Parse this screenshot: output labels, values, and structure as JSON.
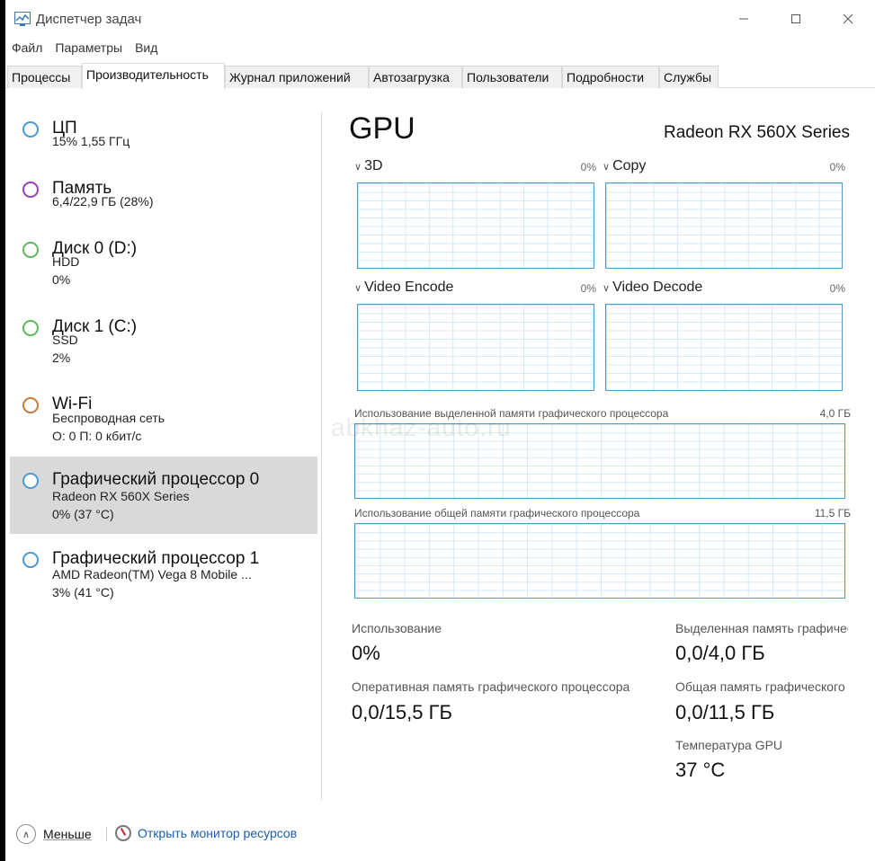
{
  "window": {
    "title": "Диспетчер задач"
  },
  "menu": [
    "Файл",
    "Параметры",
    "Вид"
  ],
  "tabs": [
    "Процессы",
    "Производительность",
    "Журнал приложений",
    "Автозагрузка",
    "Пользователи",
    "Подробности",
    "Службы"
  ],
  "active_tab": "Производительность",
  "sidebar": {
    "items": [
      {
        "title": "ЦП",
        "line1": "15%  1,55 ГГц",
        "line2": "",
        "color": "#4a9ad1"
      },
      {
        "title": "Память",
        "line1": "6,4/22,9 ГБ (28%)",
        "line2": "",
        "color": "#9b3fbd"
      },
      {
        "title": "Диск 0 (D:)",
        "line1": "HDD",
        "line2": "0%",
        "color": "#5cb85c"
      },
      {
        "title": "Диск 1 (C:)",
        "line1": "SSD",
        "line2": "2%",
        "color": "#5cb85c"
      },
      {
        "title": "Wi-Fi",
        "line1": "Беспроводная сеть",
        "line2": "О: 0  П: 0 кбит/с",
        "color": "#c87a3a"
      },
      {
        "title": "Графический процессор 0",
        "line1": "Radeon RX 560X Series",
        "line2": "0%  (37 °C)",
        "color": "#4a9ad1"
      },
      {
        "title": "Графический процессор 1",
        "line1": "AMD Radeon(TM) Vega 8 Mobile ...",
        "line2": "3%  (41 °C)",
        "color": "#4a9ad1"
      }
    ]
  },
  "main": {
    "title": "GPU",
    "model": "Radeon RX 560X Series",
    "engines": [
      {
        "label": "3D",
        "pct": "0%"
      },
      {
        "label": "Copy",
        "pct": "0%"
      },
      {
        "label": "Video Encode",
        "pct": "0%"
      },
      {
        "label": "Video Decode",
        "pct": "0%"
      }
    ],
    "dedicated": {
      "label": "Использование выделенной памяти графического процессора",
      "max": "4,0 ГБ"
    },
    "shared": {
      "label": "Использование общей памяти графического процессора",
      "max": "11,5 ГБ"
    },
    "stats": {
      "usage_label": "Использование",
      "usage_value": "0%",
      "dedicated_label": "Выделенная память графического процессора",
      "dedicated_value": "0,0/4,0 ГБ",
      "gpu_ram_label": "Оперативная память графического процессора",
      "gpu_ram_value": "0,0/15,5 ГБ",
      "shared_label": "Общая память графического процессора",
      "shared_value": "0,0/11,5 ГБ",
      "temp_label": "Температура GPU",
      "temp_value": "37 °C"
    }
  },
  "footer": {
    "less": "Меньше",
    "monitor": "Открыть монитор ресурсов"
  },
  "watermark": "abkhaz-auto.ru",
  "colors": {
    "graph_border": "#4c9bcf",
    "selected_bg": "#d9d9d9",
    "link": "#1a5fb4"
  }
}
